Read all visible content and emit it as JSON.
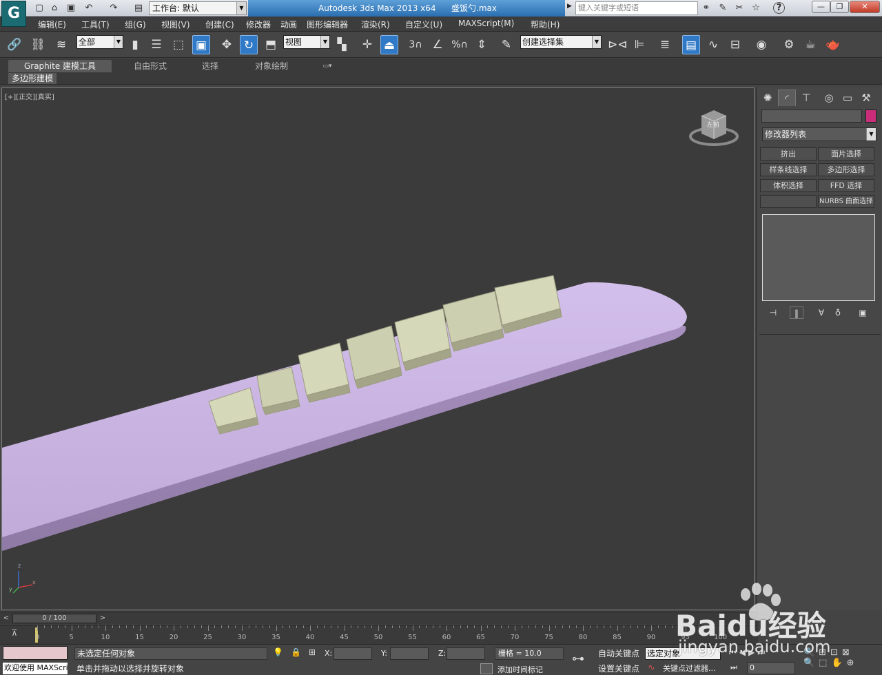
{
  "titlebar": {
    "workspace_label": "工作台: 默认",
    "app_name": "Autodesk 3ds Max  2013 x64",
    "file_name": "盛饭勺.max",
    "search_placeholder": "键入关键字或短语",
    "help_label": "?"
  },
  "menu": [
    "编辑(E)",
    "工具(T)",
    "组(G)",
    "视图(V)",
    "创建(C)",
    "修改器",
    "动画",
    "图形编辑器",
    "渲染(R)",
    "自定义(U)",
    "MAXScript(M)",
    "帮助(H)"
  ],
  "toolbar": {
    "selection_filter": "全部",
    "ref_coord": "视图",
    "named_selection": "创建选择集",
    "snap_label": "3",
    "percent_label": "%"
  },
  "ribbon": {
    "tabs": [
      "Graphite 建模工具",
      "自由形式",
      "选择",
      "对象绘制"
    ],
    "panel_label": "多边形建模"
  },
  "viewport": {
    "label": "[+][正交][真实]",
    "viewcube_text": "左前",
    "axis_labels": {
      "x": "x",
      "y": "y",
      "z": "z"
    }
  },
  "command_panel": {
    "modifier_list": "修改器列表",
    "buttons": [
      "挤出",
      "面片选择",
      "样条线选择",
      "多边形选择",
      "体积选择",
      "FFD 选择",
      "",
      "NURBS 曲面选择"
    ]
  },
  "timeline": {
    "frame_display": "0 / 100",
    "ticks": [
      "0",
      "5",
      "10",
      "15",
      "20",
      "25",
      "30",
      "35",
      "40",
      "45",
      "50",
      "55",
      "60",
      "65",
      "70",
      "75",
      "80",
      "85",
      "90",
      "95",
      "100"
    ]
  },
  "status": {
    "welcome": "欢迎使用 MAXScri",
    "selection_status": "未选定任何对象",
    "prompt": "单击并拖动以选择并旋转对象",
    "x_label": "X:",
    "y_label": "Y:",
    "z_label": "Z:",
    "grid_label": "栅格 = 10.0",
    "add_time_tag": "添加时间标记",
    "auto_key": "自动关键点",
    "set_key": "设置关键点",
    "key_target": "选定对象",
    "key_filters": "关键点过滤器...",
    "frame_field": "0"
  },
  "watermark": {
    "brand": "Baidu经验",
    "url": "jingyan.baidu.com"
  },
  "colors": {
    "viewport_bg": "#3b3b3b",
    "object_color": "#cc2d7a",
    "spoon_color": "#c9b4e0",
    "text_color": "#cfd1b4"
  }
}
